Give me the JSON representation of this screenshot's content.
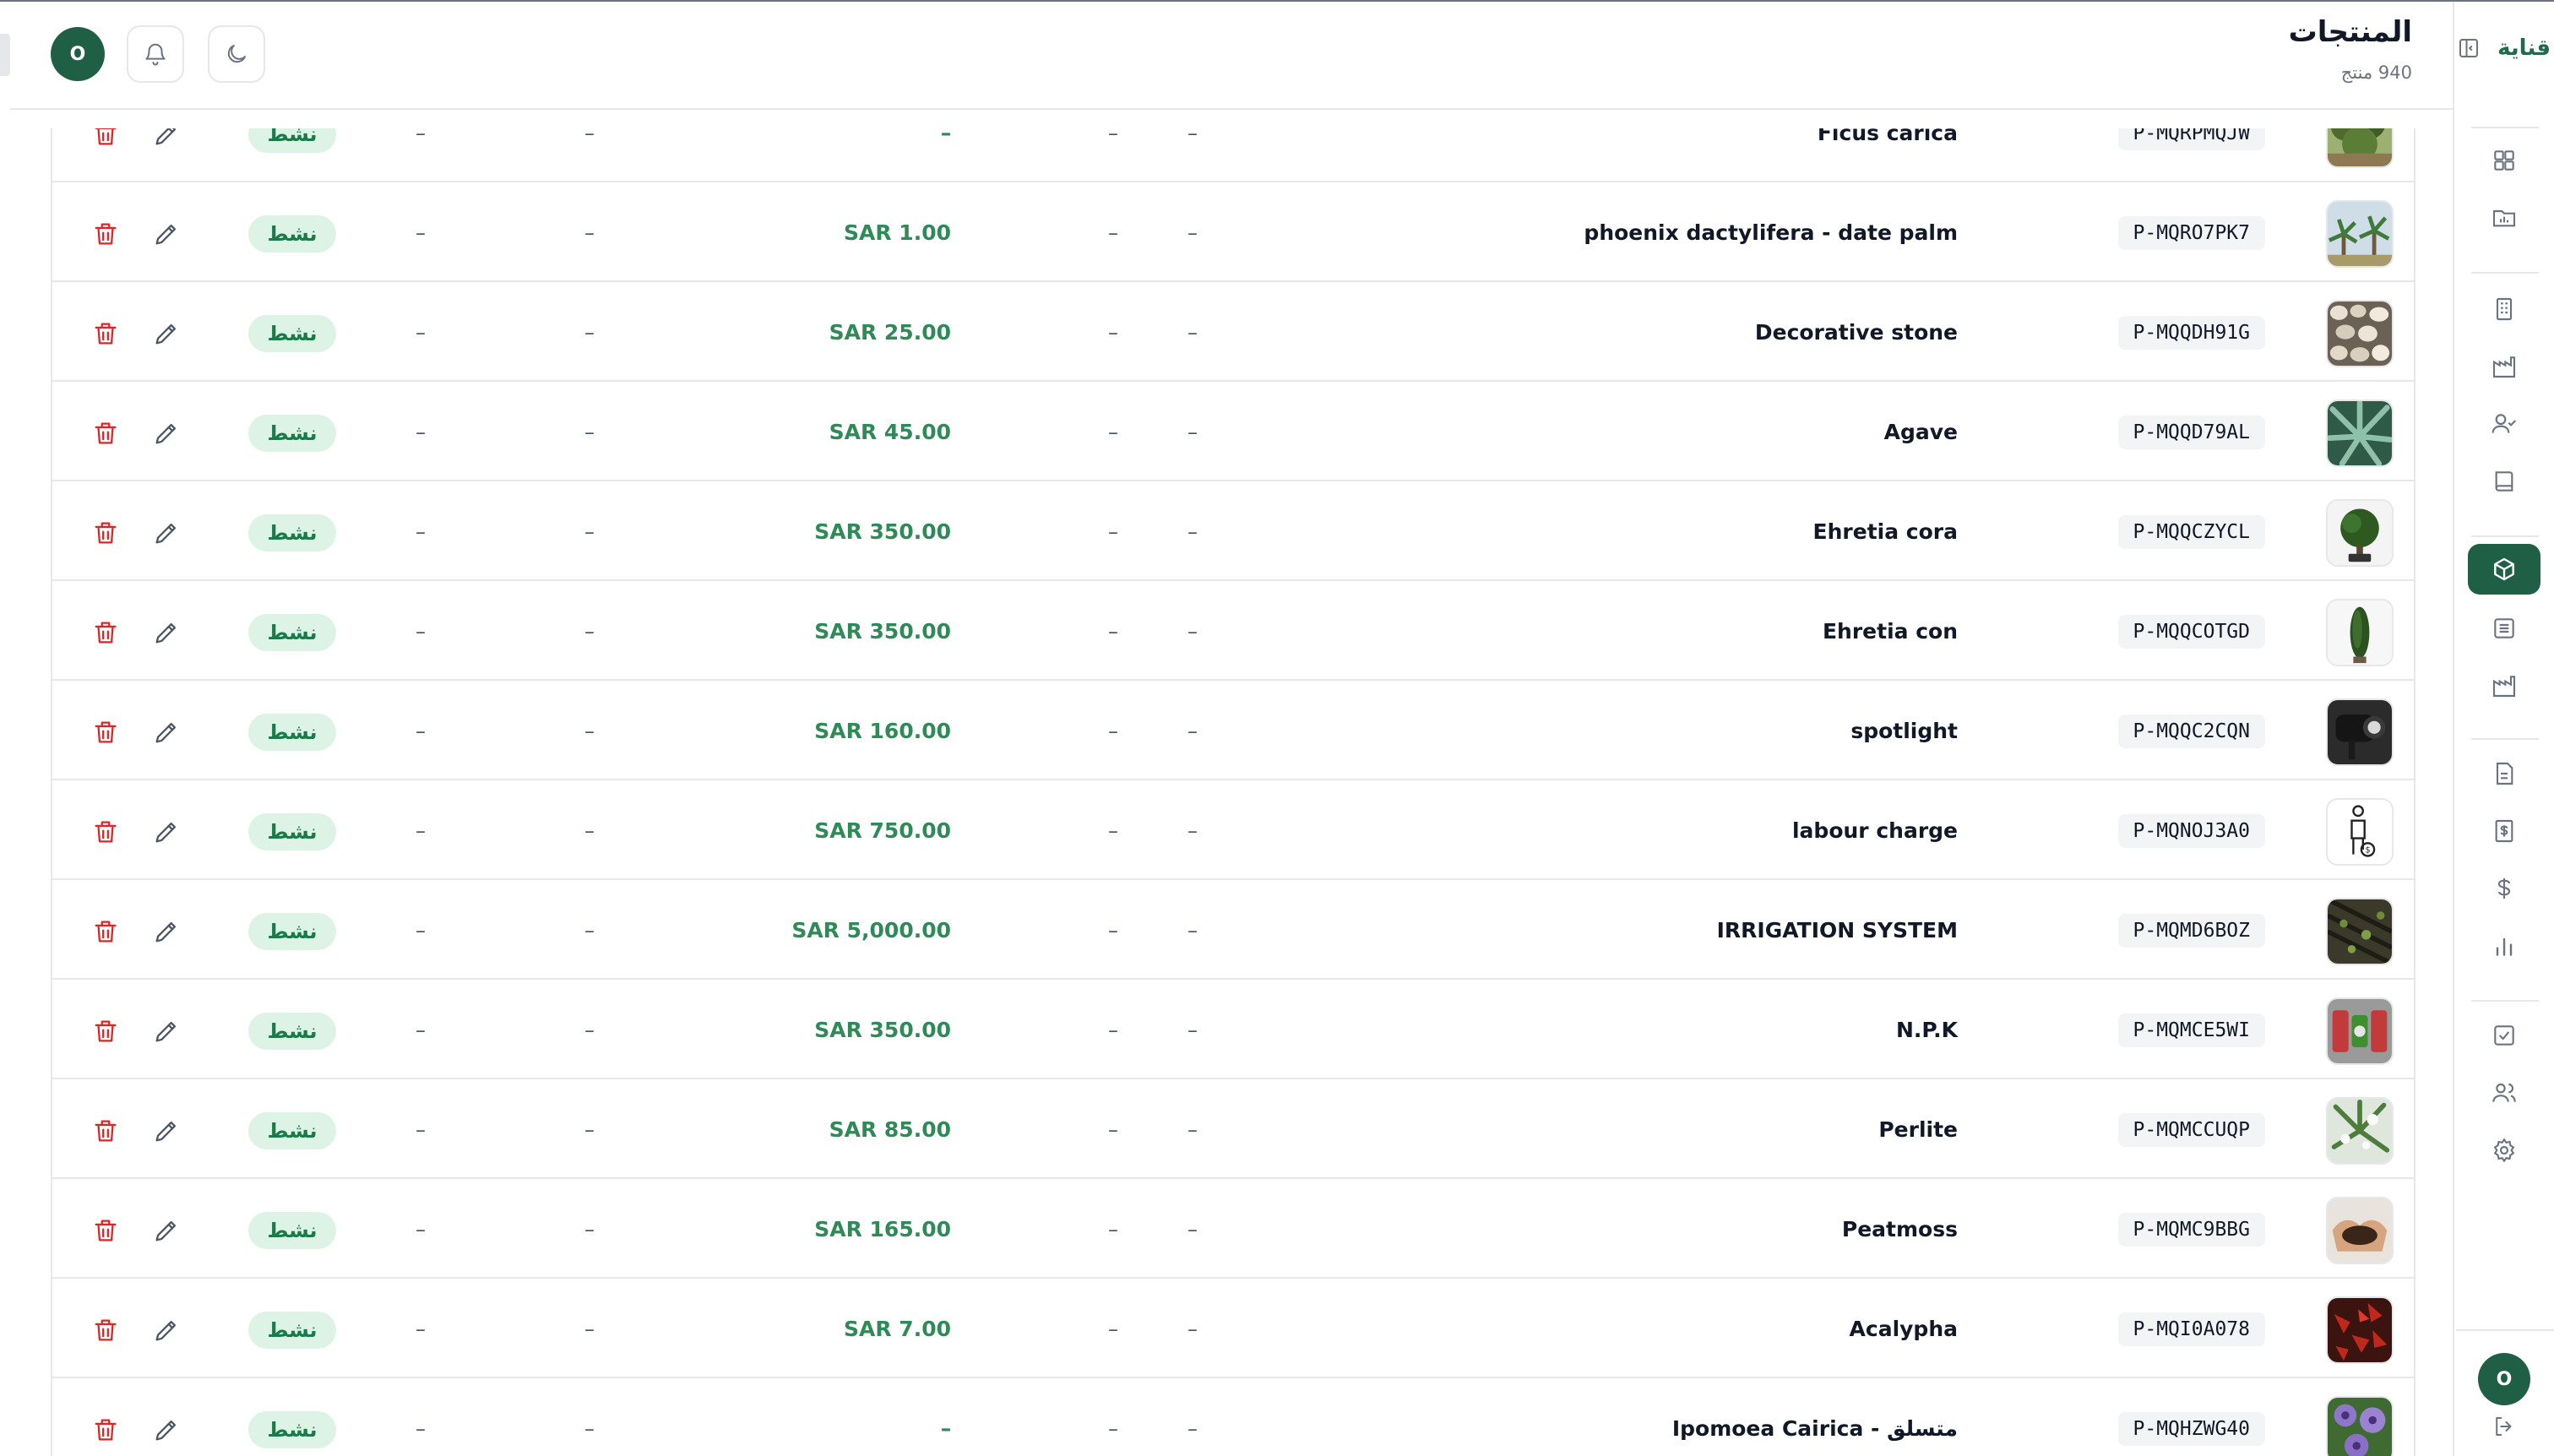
{
  "app": {
    "brand": "قناية"
  },
  "header": {
    "title": "المنتجات",
    "count": "940 منتج",
    "avatar_initial": "O"
  },
  "sidebar": {
    "avatar_initial": "O",
    "active": "products",
    "items": [
      {
        "icon": "dashboard-icon"
      },
      {
        "icon": "folder-chart-icon"
      },
      {
        "icon": "building-icon"
      },
      {
        "icon": "factory-icon"
      },
      {
        "icon": "user-check-icon"
      },
      {
        "icon": "book-icon"
      },
      {
        "icon": "package-icon",
        "active": true
      },
      {
        "icon": "list-icon"
      },
      {
        "icon": "warehouse-icon"
      },
      {
        "icon": "document-icon"
      },
      {
        "icon": "invoice-icon"
      },
      {
        "icon": "dollar-icon"
      },
      {
        "icon": "bar-chart-icon"
      },
      {
        "icon": "checkbox-icon"
      },
      {
        "icon": "users-icon"
      },
      {
        "icon": "settings-icon"
      }
    ]
  },
  "table": {
    "rows": [
      {
        "thumb": "ficus",
        "code": "P-MQRPMQJW",
        "name": "Ficus carica",
        "col1": "–",
        "col2": "–",
        "price": "–",
        "col4": "–",
        "col5": "–",
        "status": "نشط"
      },
      {
        "thumb": "palm",
        "code": "P-MQRO7PK7",
        "name": "phoenix dactylifera - date palm",
        "col1": "–",
        "col2": "–",
        "price": "SAR 1.00",
        "col4": "–",
        "col5": "–",
        "status": "نشط"
      },
      {
        "thumb": "stone",
        "code": "P-MQQDH91G",
        "name": "Decorative stone",
        "col1": "–",
        "col2": "–",
        "price": "SAR 25.00",
        "col4": "–",
        "col5": "–",
        "status": "نشط"
      },
      {
        "thumb": "agave",
        "code": "P-MQQD79AL",
        "name": "Agave",
        "col1": "–",
        "col2": "–",
        "price": "SAR 45.00",
        "col4": "–",
        "col5": "–",
        "status": "نشط"
      },
      {
        "thumb": "tree",
        "code": "P-MQQCZYCL",
        "name": "Ehretia cora",
        "col1": "–",
        "col2": "–",
        "price": "SAR 350.00",
        "col4": "–",
        "col5": "–",
        "status": "نشط"
      },
      {
        "thumb": "cone",
        "code": "P-MQQCOTGD",
        "name": "Ehretia con",
        "col1": "–",
        "col2": "–",
        "price": "SAR 350.00",
        "col4": "–",
        "col5": "–",
        "status": "نشط"
      },
      {
        "thumb": "spotlight",
        "code": "P-MQQC2CQN",
        "name": "spotlight",
        "col1": "–",
        "col2": "–",
        "price": "SAR 160.00",
        "col4": "–",
        "col5": "–",
        "status": "نشط"
      },
      {
        "thumb": "labour",
        "code": "P-MQNOJ3A0",
        "name": "labour charge",
        "col1": "–",
        "col2": "–",
        "price": "SAR 750.00",
        "col4": "–",
        "col5": "–",
        "status": "نشط"
      },
      {
        "thumb": "irrigation",
        "code": "P-MQMD6BOZ",
        "name": "IRRIGATION SYSTEM",
        "col1": "–",
        "col2": "–",
        "price": "SAR 5,000.00",
        "col4": "–",
        "col5": "–",
        "status": "نشط"
      },
      {
        "thumb": "npk",
        "code": "P-MQMCE5WI",
        "name": "N.P.K",
        "col1": "–",
        "col2": "–",
        "price": "SAR 350.00",
        "col4": "–",
        "col5": "–",
        "status": "نشط"
      },
      {
        "thumb": "perlite",
        "code": "P-MQMCCUQP",
        "name": "Perlite",
        "col1": "–",
        "col2": "–",
        "price": "SAR 85.00",
        "col4": "–",
        "col5": "–",
        "status": "نشط"
      },
      {
        "thumb": "peatmoss",
        "code": "P-MQMC9BBG",
        "name": "Peatmoss",
        "col1": "–",
        "col2": "–",
        "price": "SAR 165.00",
        "col4": "–",
        "col5": "–",
        "status": "نشط"
      },
      {
        "thumb": "acalypha",
        "code": "P-MQI0A078",
        "name": "Acalypha",
        "col1": "–",
        "col2": "–",
        "price": "SAR 7.00",
        "col4": "–",
        "col5": "–",
        "status": "نشط"
      },
      {
        "thumb": "ipomoea",
        "code": "P-MQHZWG40",
        "name": "Ipomoea Cairica - متسلق",
        "col1": "–",
        "col2": "–",
        "price": "–",
        "col4": "–",
        "col5": "–",
        "status": "نشط"
      }
    ]
  },
  "colors": {
    "brand_green": "#1f5f45",
    "price_green": "#2f8a58",
    "status_bg": "#dcf3e6",
    "delete_red": "#dc2626"
  }
}
